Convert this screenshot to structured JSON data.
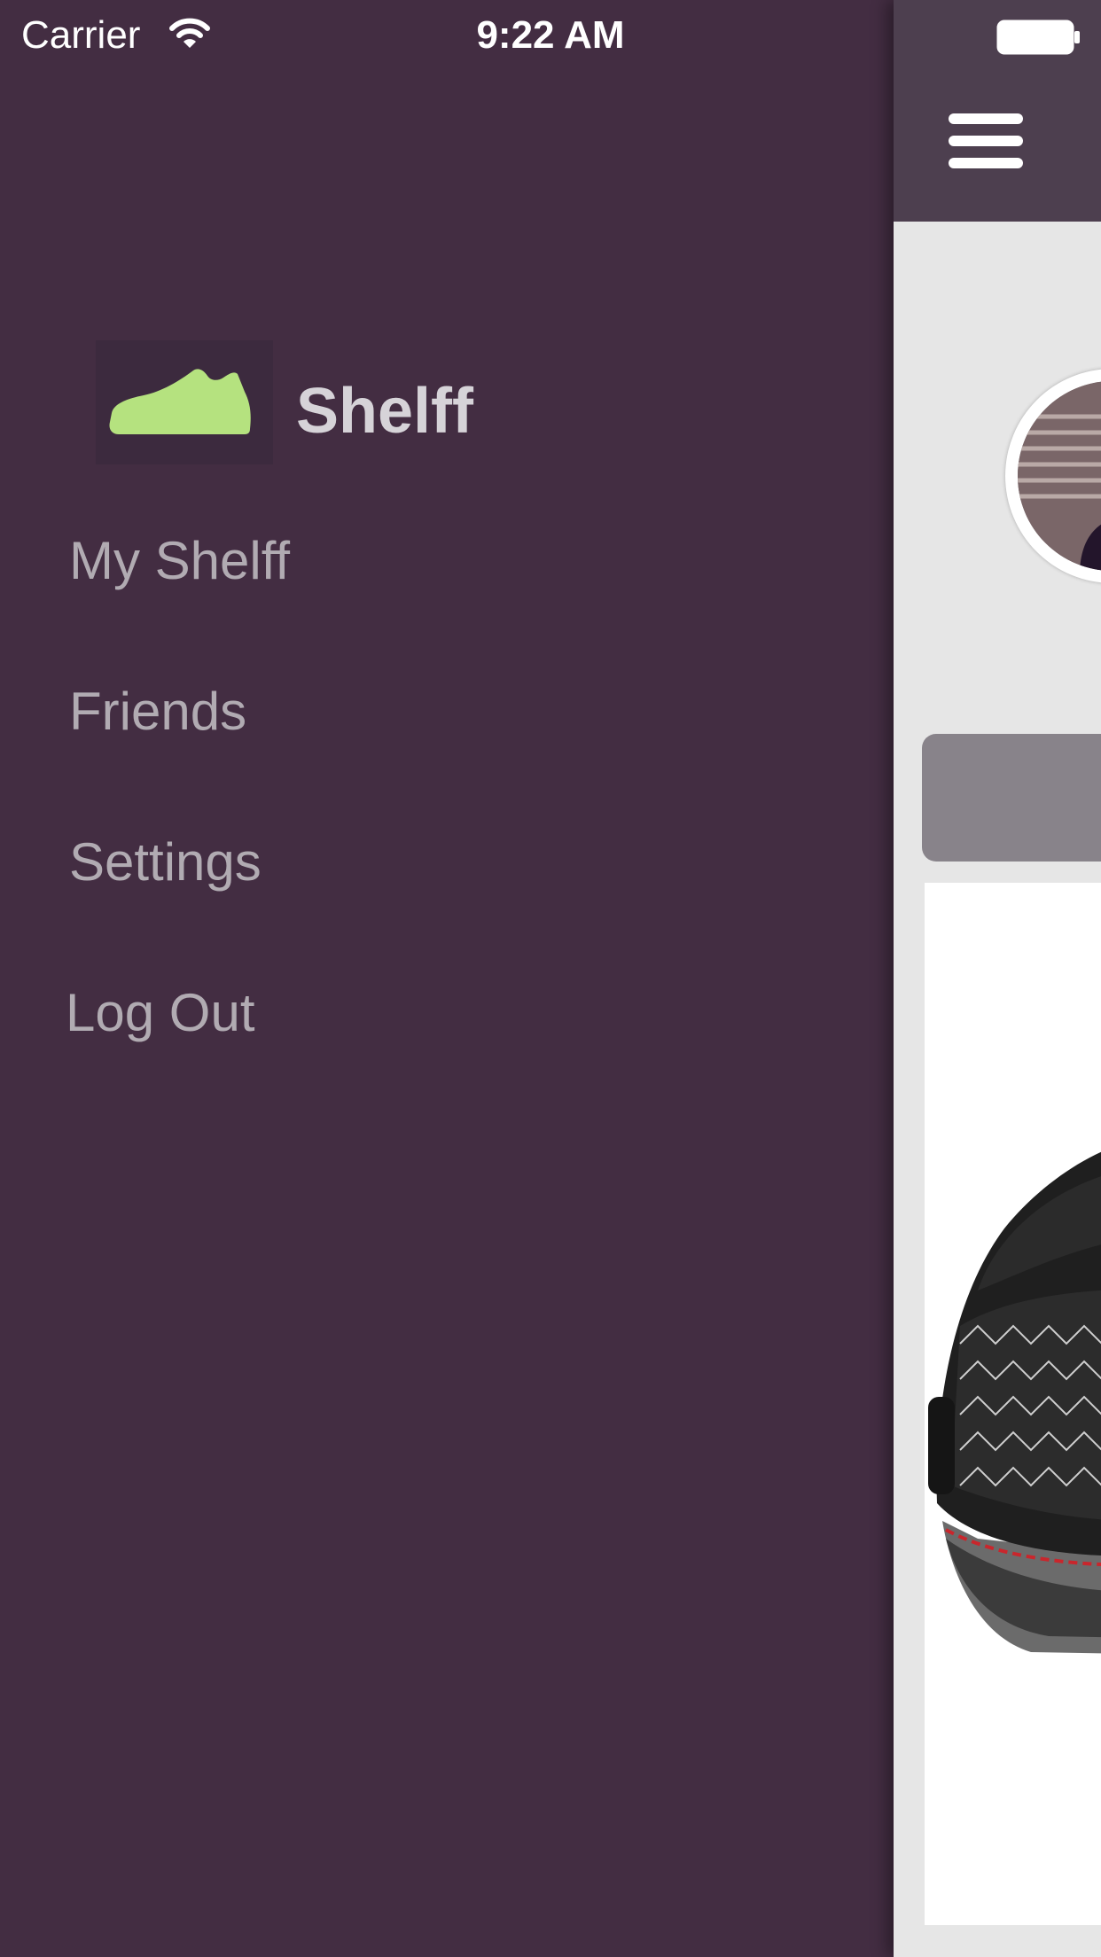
{
  "status_bar": {
    "carrier": "Carrier",
    "time": "9:22 AM",
    "wifi_icon": "wifi-icon",
    "battery_icon": "battery-icon"
  },
  "side_menu": {
    "brand": {
      "logo_icon": "sneaker-icon",
      "name": "Shelff"
    },
    "items": [
      {
        "label": "My Shelff"
      },
      {
        "label": "Friends"
      },
      {
        "label": "Settings"
      },
      {
        "label": "Log Out"
      }
    ]
  },
  "main": {
    "menu_icon": "hamburger-icon"
  },
  "colors": {
    "menu_background": "#432d42",
    "nav_bar": "#4d3f4f",
    "menu_text": "#b1abb2",
    "brand_text": "#d6d3d8",
    "logo_green": "#b5e27f",
    "content_background": "#e6e6e6",
    "action_bar": "#88838a"
  }
}
